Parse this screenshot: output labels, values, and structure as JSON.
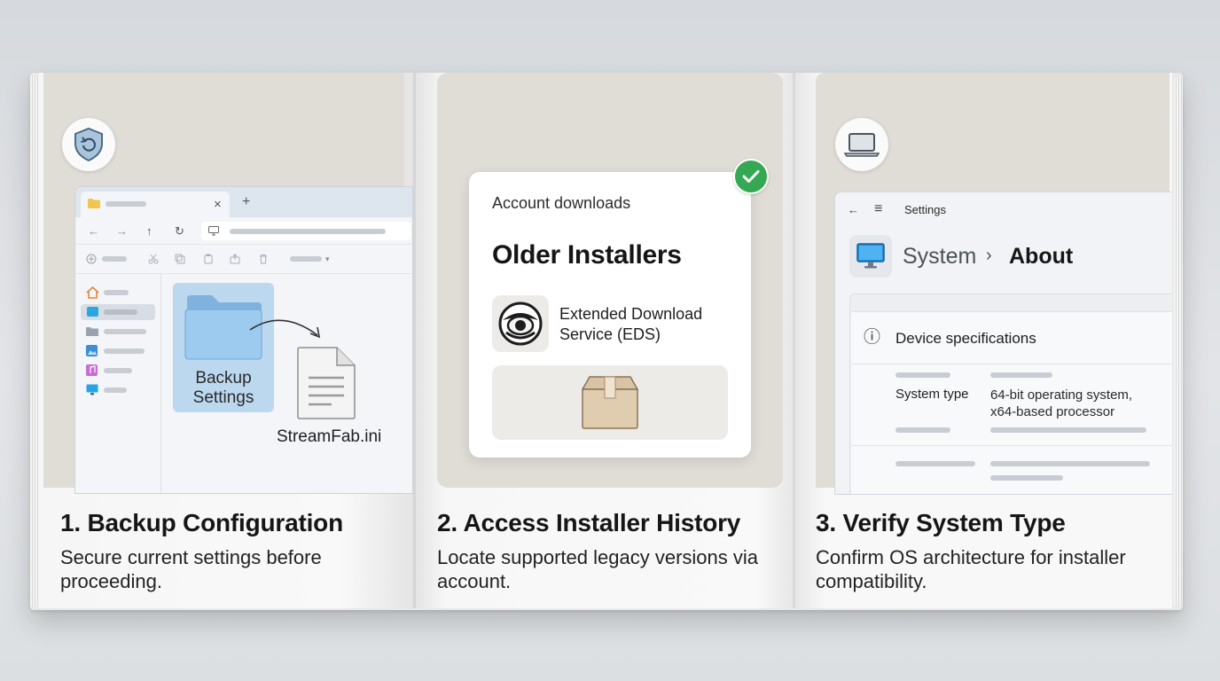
{
  "steps": [
    {
      "title": "1. Backup Configuration",
      "description": "Secure current settings before proceeding.",
      "illustration": {
        "folder_label_line1": "Backup",
        "folder_label_line2": "Settings",
        "file_name": "StreamFab.ini"
      },
      "badge_icon": "shield-restore-icon"
    },
    {
      "title": "2. Access Installer History",
      "description": "Locate supported legacy versions via account.",
      "illustration": {
        "kicker": "Account downloads",
        "heading": "Older Installers",
        "service_name_line1": "Extended Download",
        "service_name_line2": "Service (EDS)"
      },
      "badge_icon": "check-icon"
    },
    {
      "title": "3. Verify System Type",
      "description": "Confirm OS architecture for installer compatibility.",
      "illustration": {
        "window_title": "Settings",
        "breadcrumb_parent": "System",
        "breadcrumb_separator": "›",
        "breadcrumb_current": "About",
        "section_title": "Device specifications",
        "spec_label": "System type",
        "spec_value_line1": "64-bit operating system,",
        "spec_value_line2": "x64-based processor"
      },
      "badge_icon": "laptop-icon"
    }
  ],
  "glyphs": {
    "close": "×",
    "plus": "+",
    "back": "←",
    "forward": "→",
    "up": "↑",
    "refresh": "↻",
    "menu": "≡",
    "info": "ⓘ"
  },
  "colors": {
    "check_green": "#34a853",
    "folder_blue": "#9ccbef",
    "panel_beige": "#e0ddd6"
  }
}
